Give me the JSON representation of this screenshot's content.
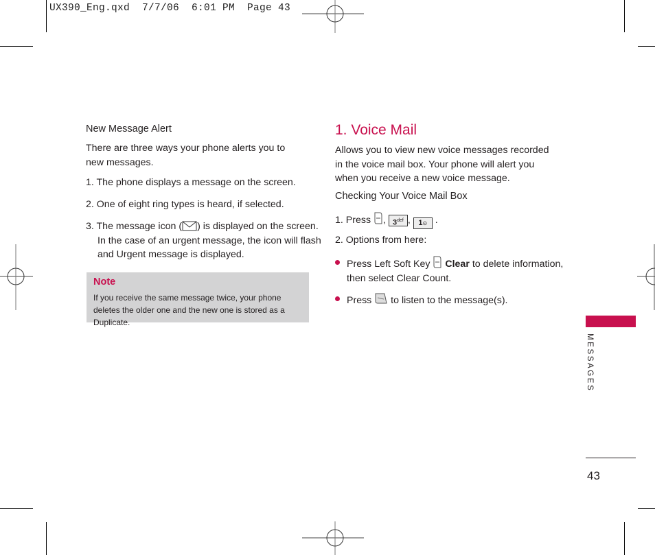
{
  "slug": "UX390_Eng.qxd  7/7/06  6:01 PM  Page 43",
  "left": {
    "heading": "New Message Alert",
    "intro": "There are three ways your phone alerts you to new messages.",
    "items": [
      "1. The phone displays a message on the screen.",
      "2. One of eight ring types is heard, if selected.",
      {
        "before": "3. The message icon (",
        "icon": "envelope-icon",
        "after": ") is displayed on the screen. In the case of an urgent message, the icon will flash and Urgent message is displayed."
      }
    ],
    "note": {
      "title": "Note",
      "text": "If you receive the same message twice, your phone deletes the older one and the new one is stored as a Duplicate."
    }
  },
  "right": {
    "title": "1. Voice Mail",
    "intro": "Allows you to view new voice messages recorded in the voice mail box. Your phone will alert you when you receive a new voice message.",
    "subheading": "Checking Your Voice Mail Box",
    "step1": {
      "label": "1. Press",
      "keys": [
        "left-soft-key-icon",
        "key-3-def-icon",
        "key-1-voicemail-icon"
      ],
      "key3_text": "3",
      "key3_sub": "def",
      "key1_text": "1"
    },
    "step2": "2. Options from here:",
    "bullets": [
      {
        "before": "Press Left Soft Key",
        "icon": "left-soft-key-icon",
        "bold": "Clear",
        "after": "to delete information, then select Clear Count."
      },
      {
        "before": "Press",
        "icon": "send-key-icon",
        "after": "to listen to the message(s)."
      }
    ]
  },
  "sidebar": {
    "section_label": "MESSAGES",
    "accent_color": "#c8104e"
  },
  "page_number": "43"
}
